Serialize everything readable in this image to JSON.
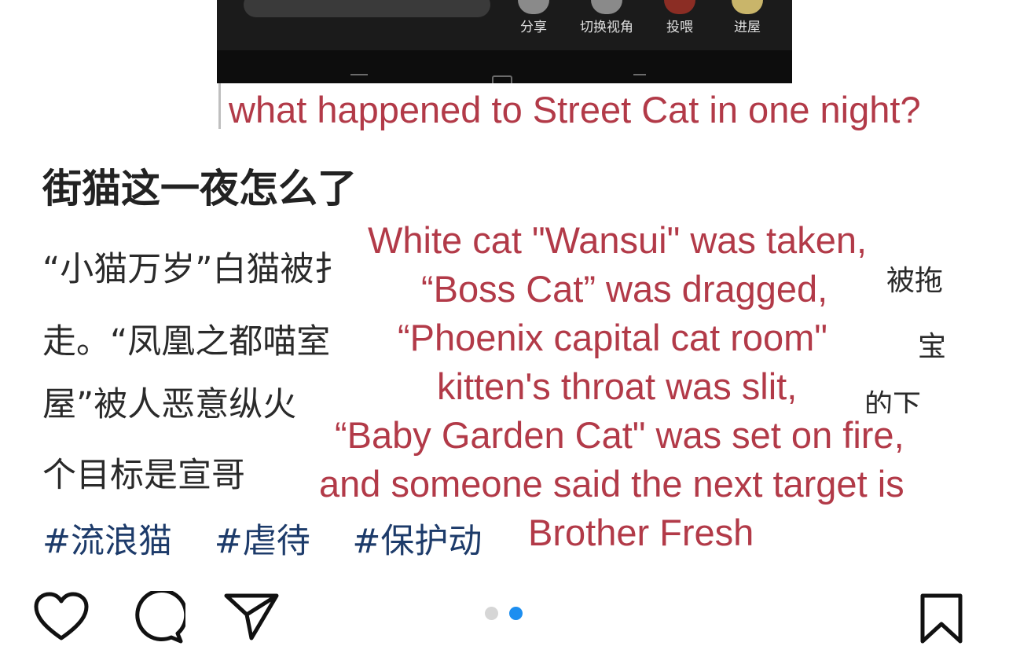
{
  "phone": {
    "actions": [
      {
        "label": "分享"
      },
      {
        "label": "切换视角"
      },
      {
        "label": "投喂"
      },
      {
        "label": "进屋"
      }
    ]
  },
  "caption": "what happened to Street Cat in one night?",
  "post": {
    "title": "街猫这一夜怎么了",
    "lines": [
      "“小猫万岁”白猫被扌",
      "走。“凤凰之都喵室",
      "屋”被人恶意纵火",
      "个目标是宣哥"
    ],
    "fragments": [
      "被拖",
      "宝",
      "的下"
    ],
    "hashtags": [
      "#流浪猫",
      "#虐待",
      "#保护动"
    ]
  },
  "translation": [
    "White cat \"Wansui\" was taken,",
    "“Boss Cat” was dragged,",
    "“Phoenix capital cat room\"",
    "kitten's throat was slit,",
    "“Baby Garden Cat\" was set on fire,",
    "and someone said the next target is",
    "Brother Fresh"
  ],
  "actions": {
    "like": "heart-icon",
    "comment": "comment-icon",
    "share": "send-icon",
    "save": "bookmark-icon"
  },
  "carousel": {
    "count": 2,
    "active": 2,
    "colors": {
      "active": "#1c8ef0",
      "inactive": "#d6d6d6"
    }
  },
  "colors": {
    "caption": "#b23a48",
    "hashtag": "#1d3b6a",
    "text": "#2a2a2a"
  }
}
